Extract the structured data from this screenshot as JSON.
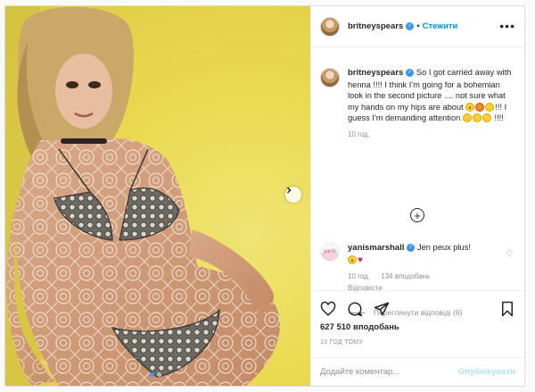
{
  "post": {
    "author": "britneyspears",
    "separator": "•",
    "follow_label": "Стежити",
    "more_label": "•••",
    "caption": {
      "username": "britneyspears",
      "text_part1": "So I got carried away with henna !!!!  I think I'm going for a bohemian look in the second picture .... not sure what my hands on my hips are about ",
      "text_part2": "!!! I guess I'm demanding attention ",
      "text_part3": " !!!!",
      "time": "10 год."
    },
    "reply": {
      "username": "yanismarshall",
      "text": "Jen peux plus!",
      "avatar_text": "yanis",
      "time": "10 год.",
      "likes": "134 вподобань",
      "reply_label": "Відповісти",
      "view_replies": "Переглянути відповіді (6)"
    },
    "likes_count": "627 510 вподобань",
    "time_ago": "10 ГОД ТОМУ",
    "comment_placeholder": "Додайте коментар...",
    "publish_label": "Опублікувати",
    "carousel": {
      "total": 2,
      "current": 1
    }
  },
  "icons": [
    "verified-icon",
    "heart-icon",
    "comment-icon",
    "share-icon",
    "bookmark-icon",
    "chevron-right-icon",
    "more-icon",
    "plus-circle-icon"
  ],
  "colors": {
    "accent": "#0095f6",
    "verified": "#3897f0",
    "muted": "#8e8e8e",
    "border": "#dbdbdb",
    "heart": "#e0245e"
  }
}
